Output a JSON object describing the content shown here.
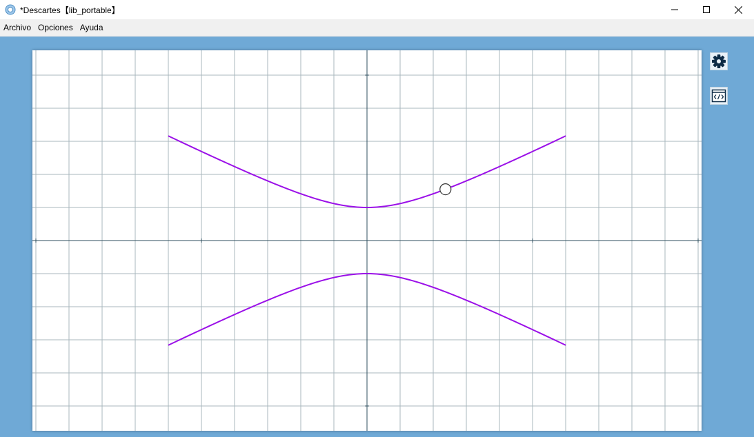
{
  "window": {
    "title": "*Descartes【lib_portable】",
    "controls": [
      "minimize",
      "maximize",
      "close"
    ]
  },
  "menu": {
    "items": [
      "Archivo",
      "Opciones",
      "Ayuda"
    ]
  },
  "icons": {
    "app": "descartes-logo-icon",
    "settings": "gear-icon",
    "code": "code-window-icon"
  },
  "colors": {
    "desktop_background": "#6fa9d6",
    "curve": "#9b10e8",
    "grid": "#a9b7bd",
    "axes": "#2f4f5f"
  },
  "chart_data": {
    "type": "line",
    "xlim": [
      -10,
      10
    ],
    "ylim": [
      -5.7,
      5.7
    ],
    "grid": true,
    "curve": "hyperbola y^2 - x^2/4 = 1",
    "series": [
      {
        "x": [
          -5.6,
          -4,
          -2,
          -1,
          0,
          1,
          2,
          4,
          5.6
        ],
        "y": [
          3.0,
          2.24,
          1.41,
          1.12,
          1.0,
          1.12,
          1.41,
          2.24,
          3.0
        ]
      },
      {
        "x": [
          -5.6,
          -4,
          -2,
          -1,
          0,
          1,
          2,
          4,
          5.6
        ],
        "y": [
          -3.0,
          -2.24,
          -1.41,
          -1.12,
          -1.0,
          -1.12,
          -1.41,
          -2.24,
          -3.0
        ]
      }
    ],
    "control_point": {
      "x": 2.37,
      "y": 1.55
    }
  }
}
